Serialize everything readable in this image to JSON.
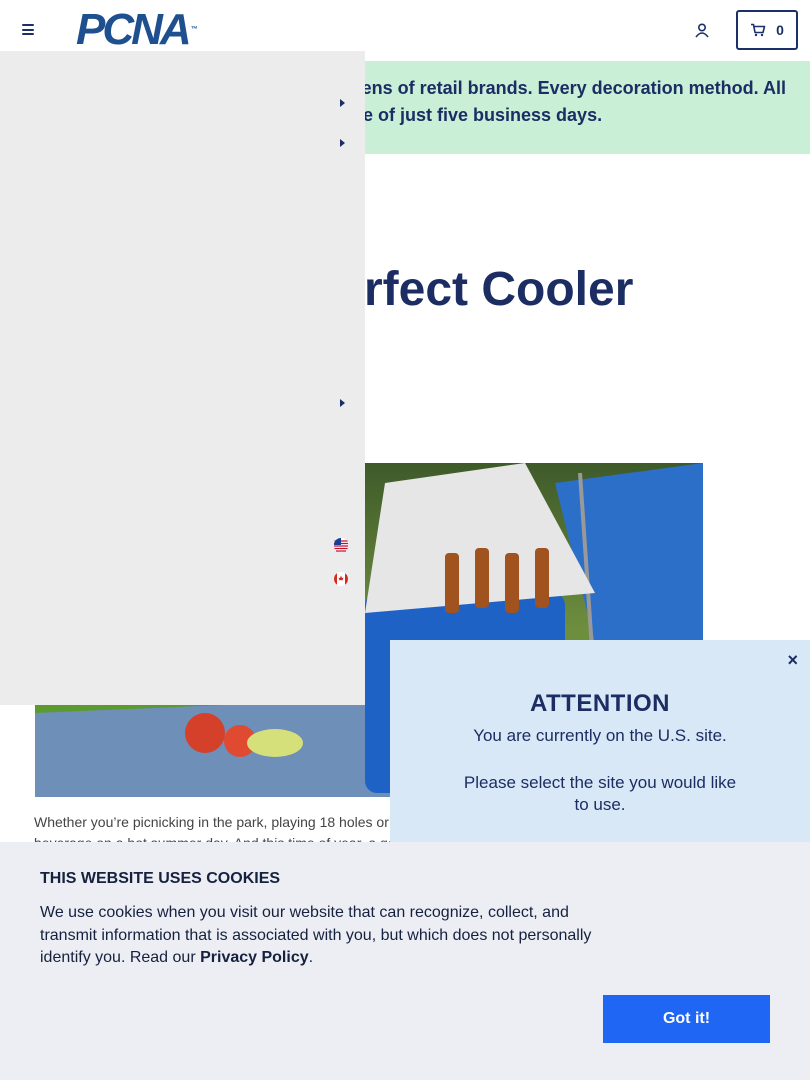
{
  "header": {
    "logo_text": "PCNA",
    "logo_tm": "™",
    "cart_count": "0"
  },
  "banner": {
    "line1": "ens of retail brands. Every decoration method. All",
    "line2": "time of just five business days."
  },
  "article": {
    "title_visible": "rfect Cooler",
    "body_line1": "Whether you’re picnicking in the park, playing 18 holes or",
    "body_line2": "beverage on a hot summer day. And this time of year, a go"
  },
  "side_menu": {
    "flags": [
      "us-flag",
      "canada-flag"
    ]
  },
  "attention": {
    "heading": "ATTENTION",
    "message1": "You are currently on the U.S. site.",
    "message2": "Please select the site you would like to use.",
    "close_label": "×"
  },
  "cookie": {
    "heading": "THIS WEBSITE USES COOKIES",
    "text_before": "We use cookies when you visit our website that can recognize, collect, and transmit information that is associated with you, but which does not personally identify you. Read our ",
    "link_label": "Privacy Policy",
    "text_after": ".",
    "button_label": "Got it!"
  },
  "colors": {
    "brand_navy": "#1b2d63",
    "banner_green": "#c9efd7",
    "button_blue": "#1f66f4",
    "popup_blue": "#d9e8f6"
  }
}
